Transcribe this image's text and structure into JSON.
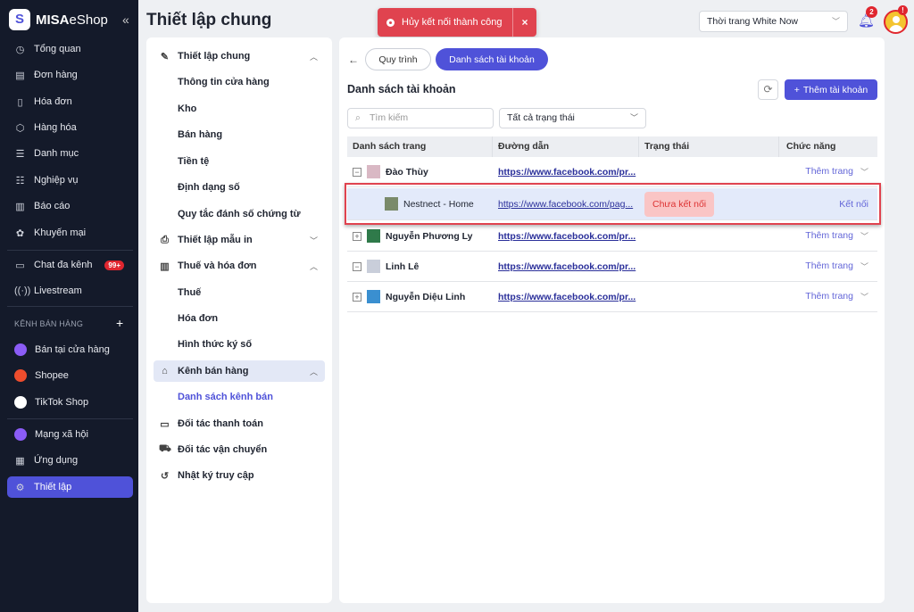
{
  "app": {
    "logo": "S",
    "brand_bold": "MISA",
    "brand_light": "eShop",
    "collapse_icon": "«"
  },
  "sidebar": {
    "items": [
      {
        "label": "Tổng quan",
        "icon": "gauge-icon"
      },
      {
        "label": "Đơn hàng",
        "icon": "order-icon"
      },
      {
        "label": "Hóa đơn",
        "icon": "invoice-icon"
      },
      {
        "label": "Hàng hóa",
        "icon": "box-icon"
      },
      {
        "label": "Danh mục",
        "icon": "list-icon"
      },
      {
        "label": "Nghiệp vụ",
        "icon": "tasks-icon"
      },
      {
        "label": "Báo cáo",
        "icon": "chart-icon"
      },
      {
        "label": "Khuyến mại",
        "icon": "gift-icon"
      },
      {
        "label": "Chat đa kênh",
        "icon": "chat-icon",
        "badge": "99+"
      },
      {
        "label": "Livestream",
        "icon": "broadcast-icon"
      }
    ],
    "section": "KÊNH BÁN HÀNG",
    "section_add": "+",
    "channels": [
      {
        "label": "Bán tại cửa hàng",
        "color": "#8b5cf6"
      },
      {
        "label": "Shopee",
        "color": "#ee4d2d"
      },
      {
        "label": "TikTok Shop",
        "color": "#ffffff"
      }
    ],
    "bottom": [
      {
        "label": "Mạng xã hội",
        "icon": "social-icon"
      },
      {
        "label": "Ứng dụng",
        "icon": "apps-icon"
      },
      {
        "label": "Thiết lập",
        "icon": "gear-icon",
        "active": true
      }
    ]
  },
  "header": {
    "title": "Thiết lập chung",
    "toast": "Hủy kết nối thành công",
    "toast_close": "×",
    "store": "Thời trang White Now",
    "notifications": "2",
    "avatar_badge": "!"
  },
  "settings_nav": {
    "items": [
      {
        "label": "Thiết lập chung",
        "icon": "wrench-icon",
        "chev": "︿"
      },
      {
        "label": "Thông tin cửa hàng",
        "sub": true
      },
      {
        "label": "Kho",
        "sub": true
      },
      {
        "label": "Bán hàng",
        "sub": true
      },
      {
        "label": "Tiền tệ",
        "sub": true
      },
      {
        "label": "Định dạng số",
        "sub": true
      },
      {
        "label": "Quy tắc đánh số chứng từ",
        "sub": true
      },
      {
        "label": "Thiết lập mẫu in",
        "icon": "printer-icon",
        "chev": "﹀"
      },
      {
        "label": "Thuế và hóa đơn",
        "icon": "bank-icon",
        "chev": "︿"
      },
      {
        "label": "Thuế",
        "sub": true
      },
      {
        "label": "Hóa đơn",
        "sub": true
      },
      {
        "label": "Hình thức ký số",
        "sub": true
      },
      {
        "label": "Kênh bán hàng",
        "icon": "store-icon",
        "chev": "︿",
        "highlight": true
      },
      {
        "label": "Danh sách kênh bán",
        "sub": true,
        "current": true
      },
      {
        "label": "Đối tác thanh toán",
        "icon": "card-icon"
      },
      {
        "label": "Đối tác vận chuyển",
        "icon": "truck-icon"
      },
      {
        "label": "Nhật ký truy cập",
        "icon": "history-icon"
      }
    ]
  },
  "content": {
    "back": "←",
    "tab1": "Quy trình",
    "tab2": "Danh sách tài khoản",
    "title": "Danh sách tài khoản",
    "add": "Thêm tài khoản",
    "search_placeholder": "Tìm kiếm",
    "filter": "Tất cả trạng thái",
    "columns": [
      "Danh sách trang",
      "Đường dẫn",
      "Trạng thái",
      "Chức năng"
    ],
    "rows": [
      {
        "toggle": "−",
        "name": "Đào Thùy",
        "url": "https://www.facebook.com/pr...",
        "status": "",
        "action": "Thêm trang",
        "chev": "﹀"
      },
      {
        "child": true,
        "name": "Nestnect - Home",
        "url": "https://www.facebook.com/pag...",
        "status": "Chưa kết nối",
        "action": "Kết nối"
      },
      {
        "toggle": "+",
        "name": "Nguyễn Phương Ly",
        "url": "https://www.facebook.com/pr...",
        "status": "",
        "action": "Thêm trang",
        "chev": "﹀"
      },
      {
        "toggle": "−",
        "name": "Linh Lê",
        "url": "https://www.facebook.com/pr...",
        "status": "",
        "action": "Thêm trang",
        "chev": "﹀"
      },
      {
        "toggle": "+",
        "name": "Nguyễn Diệu Linh",
        "url": "https://www.facebook.com/pr...",
        "status": "",
        "action": "Thêm trang",
        "chev": "﹀"
      }
    ]
  },
  "colors": {
    "accent": "#4f52d9",
    "sidebar_bg": "#141a2a",
    "toast": "#e0434f",
    "status_bg": "#fac5c5"
  }
}
